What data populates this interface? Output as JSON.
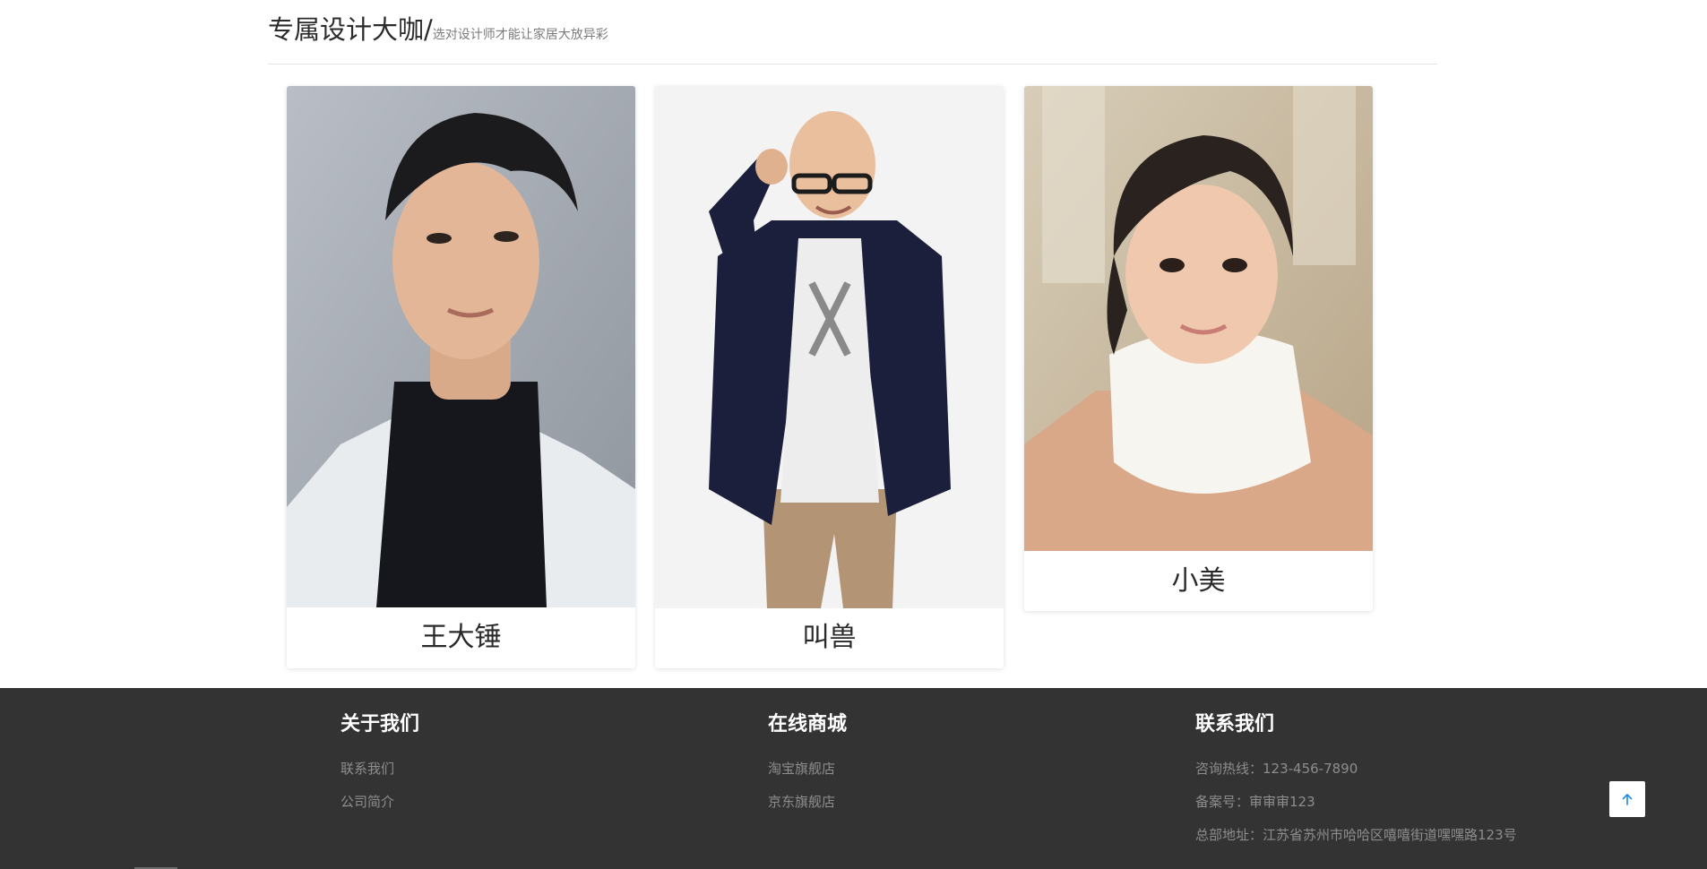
{
  "section": {
    "title": "专属设计大咖/",
    "subtitle": "选对设计师才能让家居大放异彩"
  },
  "designers": [
    {
      "name": "王大锤"
    },
    {
      "name": "叫兽"
    },
    {
      "name": "小美"
    }
  ],
  "footer": {
    "about": {
      "heading": "关于我们",
      "links": [
        "联系我们",
        "公司简介"
      ]
    },
    "shop": {
      "heading": "在线商城",
      "links": [
        "淘宝旗舰店",
        "京东旗舰店"
      ]
    },
    "contact": {
      "heading": "联系我们",
      "lines": [
        "咨询热线：123-456-7890",
        "备案号：审审审123",
        "总部地址：江苏省苏州市哈哈区嘻嘻街道嘿嘿路123号"
      ]
    }
  },
  "colors": {
    "footer_bg": "#333333",
    "accent_blue": "#1e88e5"
  },
  "icons": {
    "back_to_top": "arrow-up-icon"
  }
}
